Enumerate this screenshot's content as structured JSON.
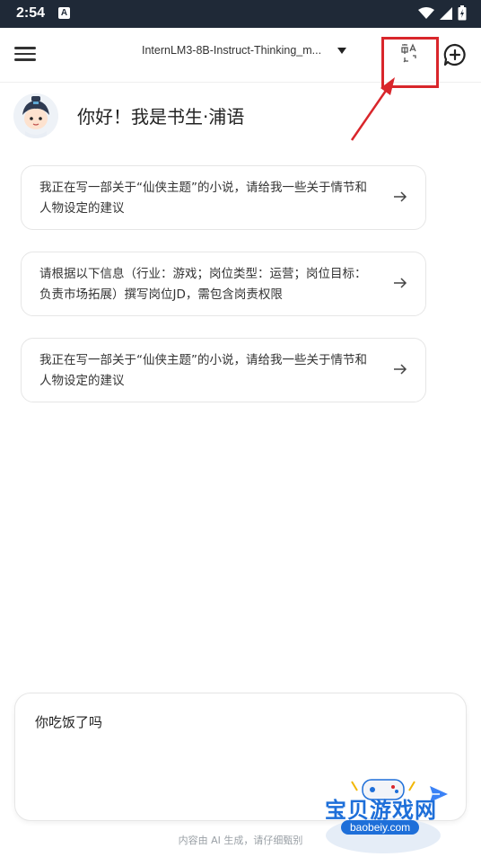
{
  "status_bar": {
    "time": "2:54",
    "notification_letter": "A"
  },
  "top_bar": {
    "model_name": "InternLM3-8B-Instruct-Thinking_m..."
  },
  "greeting": {
    "text": "你好！我是书生·浦语"
  },
  "suggestions": [
    {
      "text": "我正在写一部关于“仙侠主题”的小说，请给我一些关于情节和人物设定的建议"
    },
    {
      "text": "请根据以下信息（行业：游戏；岗位类型：运营；岗位目标：负责市场拓展）撰写岗位JD，需包含岗责权限"
    },
    {
      "text": "我正在写一部关于“仙侠主题”的小说，请给我一些关于情节和人物设定的建议"
    }
  ],
  "input": {
    "value": "你吃饭了吗"
  },
  "disclaimer": "内容由 AI 生成，请仔细甄别",
  "watermark": {
    "title": "宝贝游戏网",
    "url": "baobeiy.com"
  },
  "colors": {
    "status_bar_bg": "#1f2937",
    "annotation_red": "#d9262b",
    "send_blue": "#3b82f6",
    "watermark_blue": "#1e6fd9"
  },
  "icons": {
    "menu": "hamburger-icon",
    "dropdown": "caret-down-icon",
    "translate": "translate-icon",
    "new_chat": "new-chat-icon",
    "card_action": "arrow-right-icon",
    "send": "send-icon"
  }
}
